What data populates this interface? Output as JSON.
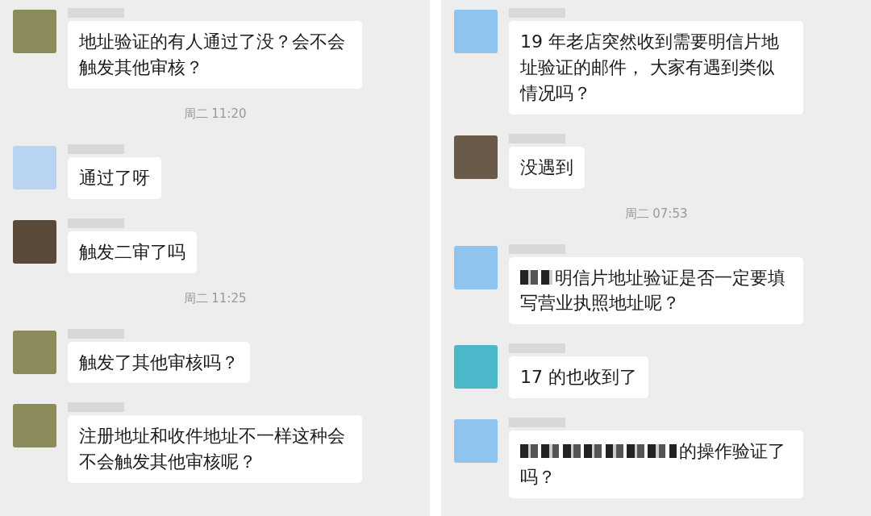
{
  "panels": [
    {
      "items": [
        {
          "kind": "message",
          "color": "#8a8a5a",
          "text": "地址验证的有人通过了没？会不会触发其他审核？",
          "redacted_prefix": false
        },
        {
          "kind": "time",
          "text": "周二 11:20"
        },
        {
          "kind": "message",
          "color": "#b8d4f0",
          "text": "通过了呀",
          "redacted_prefix": false
        },
        {
          "kind": "message",
          "color": "#5a4a3a",
          "text": "触发二审了吗",
          "redacted_prefix": false
        },
        {
          "kind": "time",
          "text": "周二 11:25"
        },
        {
          "kind": "message",
          "color": "#8a8a5a",
          "text": "触发了其他审核吗？",
          "redacted_prefix": false
        },
        {
          "kind": "message",
          "color": "#8a8a5a",
          "text": "注册地址和收件地址不一样这种会不会触发其他审核呢？",
          "redacted_prefix": false
        }
      ]
    },
    {
      "items": [
        {
          "kind": "message",
          "color": "#8ec4ee",
          "text": "19 年老店突然收到需要明信片地址验证的邮件， 大家有遇到类似情况吗？",
          "redacted_prefix": false
        },
        {
          "kind": "message",
          "color": "#6a5a4a",
          "text": "没遇到",
          "redacted_prefix": false
        },
        {
          "kind": "time",
          "text": "周二 07:53"
        },
        {
          "kind": "message",
          "color": "#8ec4ee",
          "text": "明信片地址验证是否一定要填写营业执照地址呢？",
          "redacted_prefix": true
        },
        {
          "kind": "message",
          "color": "#4ab8c8",
          "text": "17 的也收到了",
          "redacted_prefix": false
        },
        {
          "kind": "message",
          "color": "#8ec4ee",
          "text": "的操作验证了吗？",
          "redacted_prefix": true
        }
      ]
    }
  ]
}
